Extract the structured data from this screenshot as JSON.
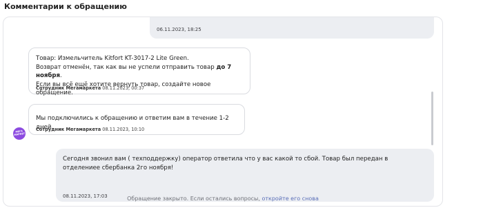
{
  "section": {
    "title": "Комментарии к обращению"
  },
  "messages": {
    "top_outgoing": {
      "time": "06.11.2023, 18:25"
    },
    "support_1": {
      "line1": "Товар: Измельчитель Kitfort KT-3017-2 Lite Green.",
      "line2_start": "Возврат отменён, так как вы не успели отправить товар ",
      "line2_bold": "до 7 ноября",
      "line2_end": ".",
      "line3": "Если вы всё ещё хотите вернуть товар, создайте новое обращение.",
      "sender": "Сотрудник Мегамаркета",
      "time": "08.11.2023, 00:37"
    },
    "support_2": {
      "text": "Мы подключились к обращению и ответим вам в течение 1-2 дней.",
      "sender": "Сотрудник Мегамаркета",
      "time": "08.11.2023, 10:10"
    },
    "avatar_text": "МЕГА МАРКЕТ",
    "user_outgoing": {
      "text": "Сегодня звонил вам ( техподдержку) оператор ответила что у вас какой то сбой. Товар был передан в отделениее сбербанка 2го ноября!",
      "time": "08.11.2023, 17:03"
    }
  },
  "footer": {
    "closed_text": "Обращение закрыто. Если остались вопросы,",
    "reopen_link": "откройте его снова"
  },
  "colors": {
    "avatar": "#8c4be0",
    "outgoing_bubble": "#eceef2",
    "link": "#5a6fb8"
  }
}
